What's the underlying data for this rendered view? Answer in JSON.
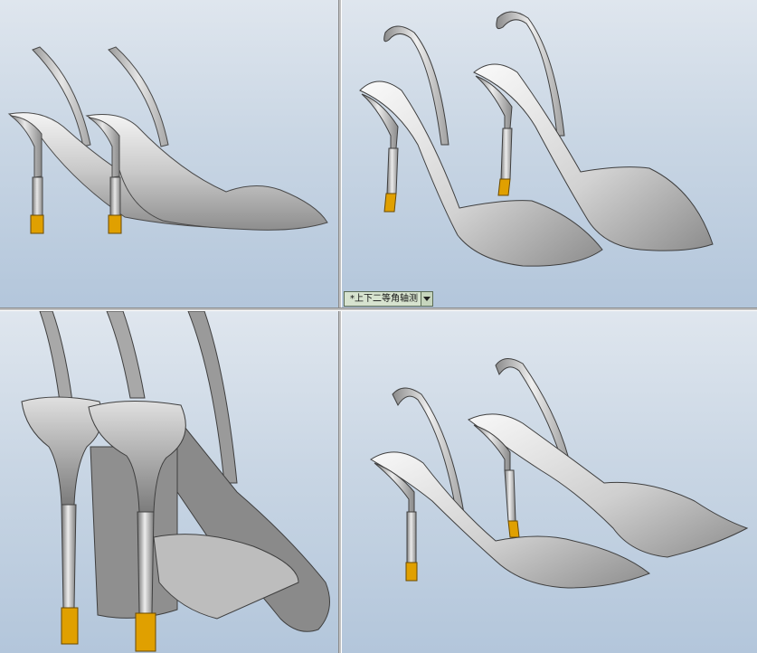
{
  "app": {
    "view_orientation": {
      "label": "*上下二等角轴测",
      "icon": "chevron-down-icon"
    }
  },
  "viewports": [
    {
      "id": "top-left",
      "content": "shoe-pair-side-view"
    },
    {
      "id": "top-right",
      "content": "shoe-pair-dimetric-view"
    },
    {
      "id": "bottom-left",
      "content": "shoe-pair-rear-view"
    },
    {
      "id": "bottom-right",
      "content": "shoe-pair-isometric-view"
    }
  ],
  "colors": {
    "background_top": "#dfe6ee",
    "background_bottom": "#b3c6db",
    "shoe_body": "#b8b8b8",
    "shoe_highlight": "#f2f2f2",
    "shoe_edge": "#4a4a4a",
    "heel_tip": "#e0a000"
  }
}
